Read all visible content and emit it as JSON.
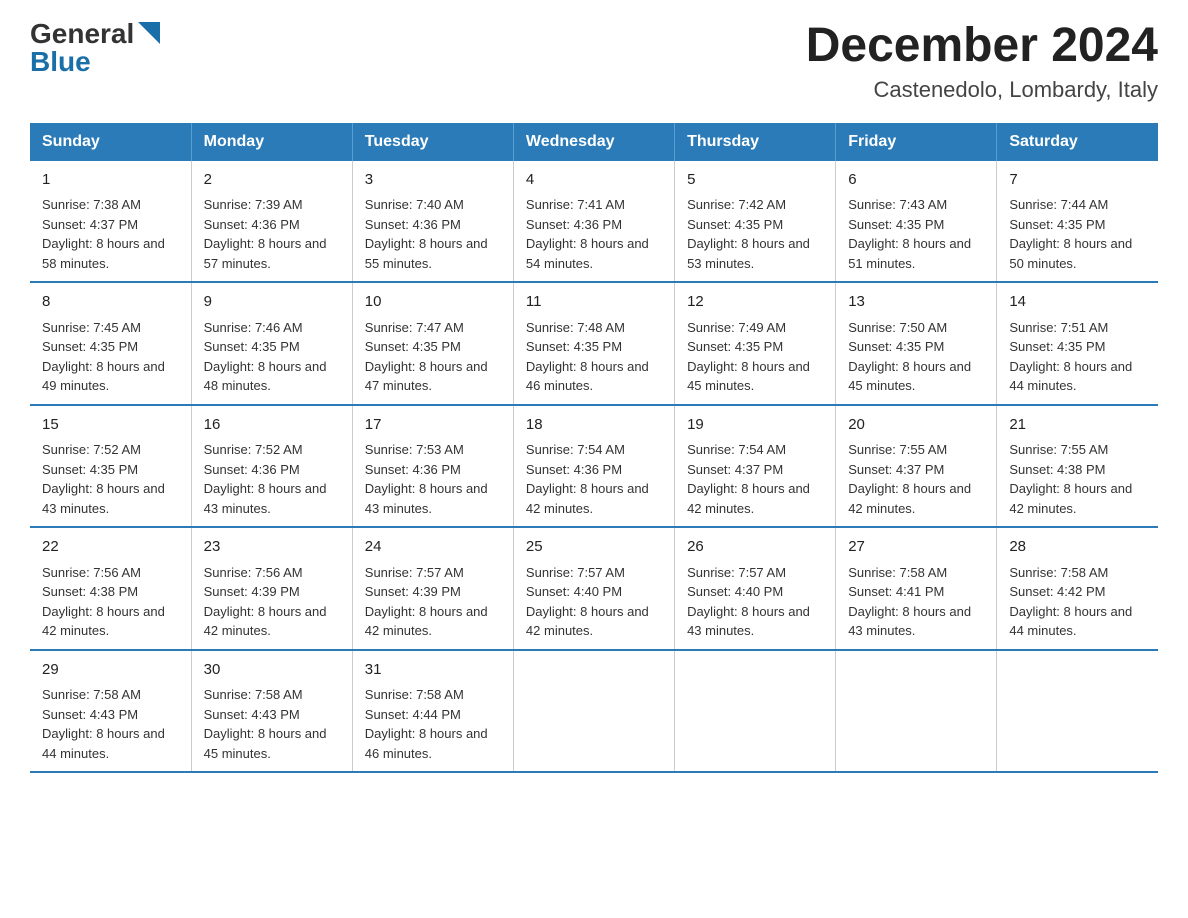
{
  "header": {
    "logo_general": "General",
    "logo_blue": "Blue",
    "month_year": "December 2024",
    "location": "Castenedolo, Lombardy, Italy"
  },
  "weekdays": [
    "Sunday",
    "Monday",
    "Tuesday",
    "Wednesday",
    "Thursday",
    "Friday",
    "Saturday"
  ],
  "weeks": [
    [
      {
        "day": "1",
        "sunrise": "7:38 AM",
        "sunset": "4:37 PM",
        "daylight": "8 hours and 58 minutes."
      },
      {
        "day": "2",
        "sunrise": "7:39 AM",
        "sunset": "4:36 PM",
        "daylight": "8 hours and 57 minutes."
      },
      {
        "day": "3",
        "sunrise": "7:40 AM",
        "sunset": "4:36 PM",
        "daylight": "8 hours and 55 minutes."
      },
      {
        "day": "4",
        "sunrise": "7:41 AM",
        "sunset": "4:36 PM",
        "daylight": "8 hours and 54 minutes."
      },
      {
        "day": "5",
        "sunrise": "7:42 AM",
        "sunset": "4:35 PM",
        "daylight": "8 hours and 53 minutes."
      },
      {
        "day": "6",
        "sunrise": "7:43 AM",
        "sunset": "4:35 PM",
        "daylight": "8 hours and 51 minutes."
      },
      {
        "day": "7",
        "sunrise": "7:44 AM",
        "sunset": "4:35 PM",
        "daylight": "8 hours and 50 minutes."
      }
    ],
    [
      {
        "day": "8",
        "sunrise": "7:45 AM",
        "sunset": "4:35 PM",
        "daylight": "8 hours and 49 minutes."
      },
      {
        "day": "9",
        "sunrise": "7:46 AM",
        "sunset": "4:35 PM",
        "daylight": "8 hours and 48 minutes."
      },
      {
        "day": "10",
        "sunrise": "7:47 AM",
        "sunset": "4:35 PM",
        "daylight": "8 hours and 47 minutes."
      },
      {
        "day": "11",
        "sunrise": "7:48 AM",
        "sunset": "4:35 PM",
        "daylight": "8 hours and 46 minutes."
      },
      {
        "day": "12",
        "sunrise": "7:49 AM",
        "sunset": "4:35 PM",
        "daylight": "8 hours and 45 minutes."
      },
      {
        "day": "13",
        "sunrise": "7:50 AM",
        "sunset": "4:35 PM",
        "daylight": "8 hours and 45 minutes."
      },
      {
        "day": "14",
        "sunrise": "7:51 AM",
        "sunset": "4:35 PM",
        "daylight": "8 hours and 44 minutes."
      }
    ],
    [
      {
        "day": "15",
        "sunrise": "7:52 AM",
        "sunset": "4:35 PM",
        "daylight": "8 hours and 43 minutes."
      },
      {
        "day": "16",
        "sunrise": "7:52 AM",
        "sunset": "4:36 PM",
        "daylight": "8 hours and 43 minutes."
      },
      {
        "day": "17",
        "sunrise": "7:53 AM",
        "sunset": "4:36 PM",
        "daylight": "8 hours and 43 minutes."
      },
      {
        "day": "18",
        "sunrise": "7:54 AM",
        "sunset": "4:36 PM",
        "daylight": "8 hours and 42 minutes."
      },
      {
        "day": "19",
        "sunrise": "7:54 AM",
        "sunset": "4:37 PM",
        "daylight": "8 hours and 42 minutes."
      },
      {
        "day": "20",
        "sunrise": "7:55 AM",
        "sunset": "4:37 PM",
        "daylight": "8 hours and 42 minutes."
      },
      {
        "day": "21",
        "sunrise": "7:55 AM",
        "sunset": "4:38 PM",
        "daylight": "8 hours and 42 minutes."
      }
    ],
    [
      {
        "day": "22",
        "sunrise": "7:56 AM",
        "sunset": "4:38 PM",
        "daylight": "8 hours and 42 minutes."
      },
      {
        "day": "23",
        "sunrise": "7:56 AM",
        "sunset": "4:39 PM",
        "daylight": "8 hours and 42 minutes."
      },
      {
        "day": "24",
        "sunrise": "7:57 AM",
        "sunset": "4:39 PM",
        "daylight": "8 hours and 42 minutes."
      },
      {
        "day": "25",
        "sunrise": "7:57 AM",
        "sunset": "4:40 PM",
        "daylight": "8 hours and 42 minutes."
      },
      {
        "day": "26",
        "sunrise": "7:57 AM",
        "sunset": "4:40 PM",
        "daylight": "8 hours and 43 minutes."
      },
      {
        "day": "27",
        "sunrise": "7:58 AM",
        "sunset": "4:41 PM",
        "daylight": "8 hours and 43 minutes."
      },
      {
        "day": "28",
        "sunrise": "7:58 AM",
        "sunset": "4:42 PM",
        "daylight": "8 hours and 44 minutes."
      }
    ],
    [
      {
        "day": "29",
        "sunrise": "7:58 AM",
        "sunset": "4:43 PM",
        "daylight": "8 hours and 44 minutes."
      },
      {
        "day": "30",
        "sunrise": "7:58 AM",
        "sunset": "4:43 PM",
        "daylight": "8 hours and 45 minutes."
      },
      {
        "day": "31",
        "sunrise": "7:58 AM",
        "sunset": "4:44 PM",
        "daylight": "8 hours and 46 minutes."
      },
      {
        "day": "",
        "sunrise": "",
        "sunset": "",
        "daylight": ""
      },
      {
        "day": "",
        "sunrise": "",
        "sunset": "",
        "daylight": ""
      },
      {
        "day": "",
        "sunrise": "",
        "sunset": "",
        "daylight": ""
      },
      {
        "day": "",
        "sunrise": "",
        "sunset": "",
        "daylight": ""
      }
    ]
  ],
  "labels": {
    "sunrise": "Sunrise:",
    "sunset": "Sunset:",
    "daylight": "Daylight:"
  }
}
